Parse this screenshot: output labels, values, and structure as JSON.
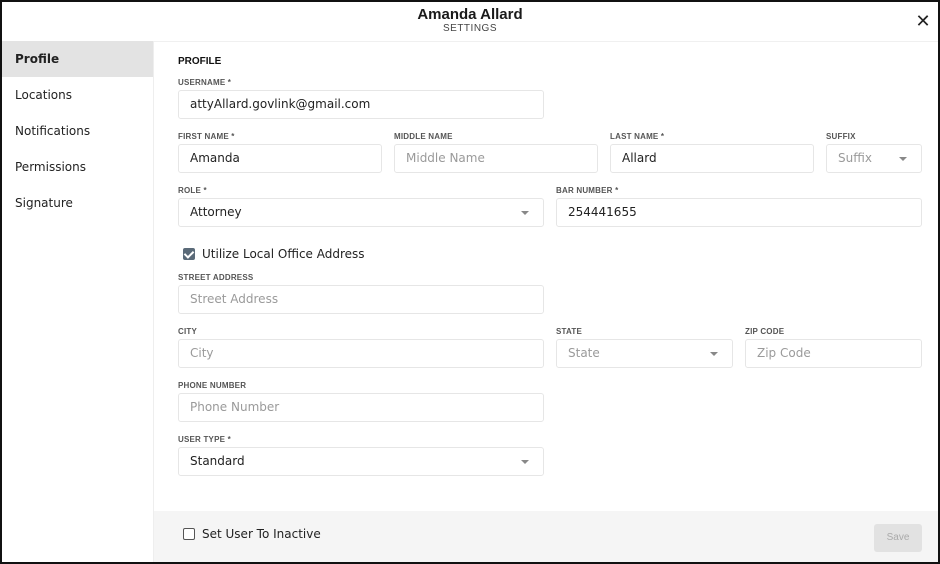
{
  "header": {
    "title": "Amanda Allard",
    "subtitle": "SETTINGS",
    "close_icon": "✕"
  },
  "sidebar": {
    "items": [
      {
        "label": "Profile",
        "active": true
      },
      {
        "label": "Locations",
        "active": false
      },
      {
        "label": "Notifications",
        "active": false
      },
      {
        "label": "Permissions",
        "active": false
      },
      {
        "label": "Signature",
        "active": false
      }
    ]
  },
  "profile": {
    "section_title": "PROFILE",
    "username": {
      "label": "USERNAME *",
      "value": "attyAllard.govlink@gmail.com"
    },
    "first_name": {
      "label": "FIRST NAME *",
      "value": "Amanda"
    },
    "middle_name": {
      "label": "MIDDLE NAME",
      "placeholder": "Middle Name"
    },
    "last_name": {
      "label": "LAST NAME *",
      "value": "Allard"
    },
    "suffix": {
      "label": "SUFFIX",
      "placeholder": "Suffix"
    },
    "role": {
      "label": "ROLE *",
      "value": "Attorney"
    },
    "bar_number": {
      "label": "BAR NUMBER *",
      "value": "254441655"
    },
    "utilize_local_office": {
      "label": "Utilize Local Office Address",
      "checked": true
    },
    "street_address": {
      "label": "STREET ADDRESS",
      "placeholder": "Street Address"
    },
    "city": {
      "label": "CITY",
      "placeholder": "City"
    },
    "state": {
      "label": "STATE",
      "placeholder": "State"
    },
    "zip_code": {
      "label": "ZIP CODE",
      "placeholder": "Zip Code"
    },
    "phone_number": {
      "label": "PHONE NUMBER",
      "placeholder": "Phone Number"
    },
    "user_type": {
      "label": "USER TYPE *",
      "value": "Standard"
    }
  },
  "footer": {
    "inactive_label": "Set User To Inactive",
    "inactive_checked": false,
    "save_label": "Save"
  }
}
